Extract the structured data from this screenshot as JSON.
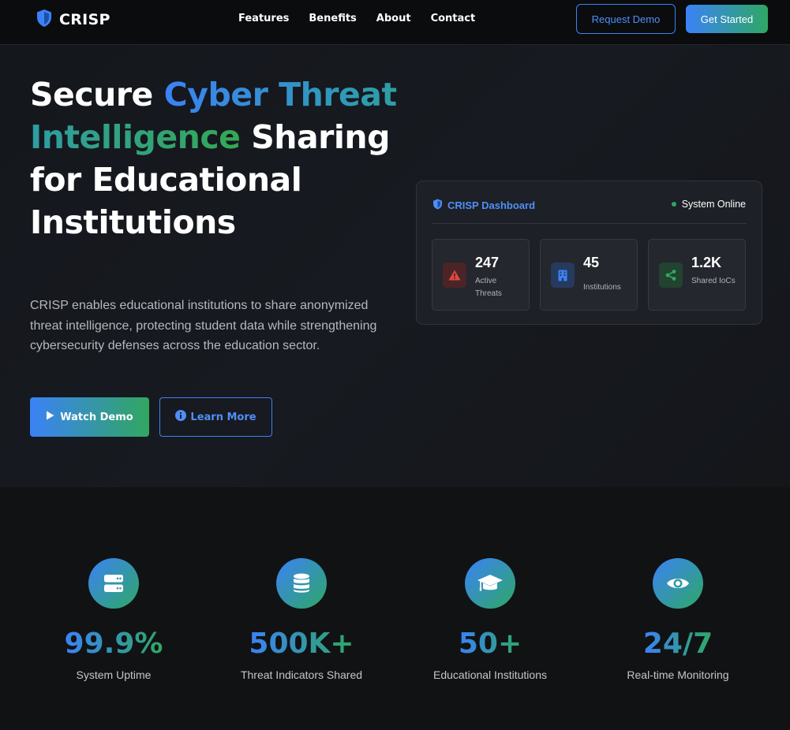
{
  "nav": {
    "brand": "CRISP",
    "links": [
      "Features",
      "Benefits",
      "About",
      "Contact"
    ],
    "request_demo": "Request Demo",
    "get_started": "Get Started"
  },
  "hero": {
    "title_part1": "Secure ",
    "title_highlight": "Cyber Threat Intelligence",
    "title_part2": " Sharing for Educational Institutions",
    "description": "CRISP enables educational institutions to share anonymized threat intelligence, protecting student data while strengthening cybersecurity defenses across the education sector.",
    "watch_demo": "Watch Demo",
    "learn_more": "Learn More"
  },
  "dashboard": {
    "title": "CRISP Dashboard",
    "status": "System Online",
    "stats": [
      {
        "value": "247",
        "label": "Active Threats",
        "icon": "warning-icon",
        "color": "#e0483f"
      },
      {
        "value": "45",
        "label": "Institutions",
        "icon": "building-icon",
        "color": "#3b82f6"
      },
      {
        "value": "1.2K",
        "label": "Shared IoCs",
        "icon": "share-icon",
        "color": "#2ea864"
      }
    ]
  },
  "metrics": [
    {
      "value": "99.9%",
      "label": "System Uptime",
      "icon": "server-icon"
    },
    {
      "value": "500K+",
      "label": "Threat Indicators Shared",
      "icon": "database-icon"
    },
    {
      "value": "50+",
      "label": "Educational Institutions",
      "icon": "graduation-cap-icon"
    },
    {
      "value": "24/7",
      "label": "Real-time Monitoring",
      "icon": "eye-icon"
    }
  ],
  "colors": {
    "accent_blue": "#3b82f6",
    "accent_green": "#2ea864",
    "background": "#0f1013"
  }
}
